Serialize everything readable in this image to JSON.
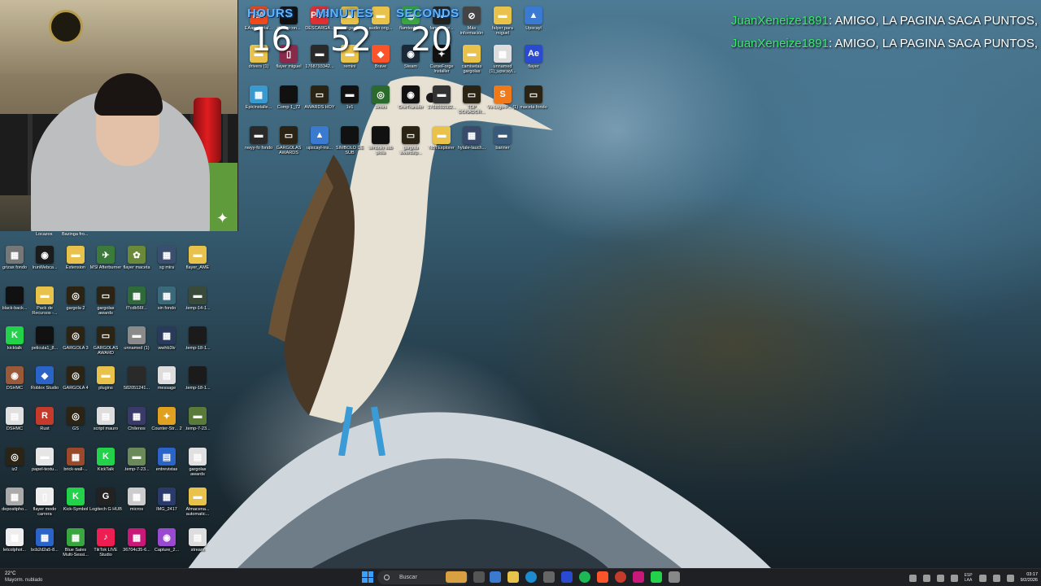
{
  "timer": {
    "hours_label": "HOURS",
    "minutes_label": "MINUTES",
    "seconds_label": "SECONDS",
    "hours": "16",
    "minutes": "52",
    "seconds": "20"
  },
  "chat": [
    {
      "user": "JuanXeneize1891",
      "message": ": AMIGO, LA PAGINA SACA PUNTOS,"
    },
    {
      "user": "JuanXeneize1891",
      "message": ": AMIGO, LA PAGINA SACA PUNTOS,"
    }
  ],
  "webcam": {
    "caption_left": "Locazos",
    "caption_right": "Bazinga fro..."
  },
  "desktop_icons": [
    {
      "label": "grizas fondo",
      "color": "#777777",
      "glyph": "▦"
    },
    {
      "label": "IrunWebca...",
      "color": "#1b1b1b",
      "glyph": "◉"
    },
    {
      "label": "Extension",
      "color": "#e8c24a",
      "glyph": "▬"
    },
    {
      "label": "MSI Afterburner",
      "color": "#3c7a3c",
      "glyph": "✈"
    },
    {
      "label": "flayer maceta",
      "color": "#6a8a3a",
      "glyph": "✿"
    },
    {
      "label": "sg mira",
      "color": "#3a4f6f",
      "glyph": "▦"
    },
    {
      "label": "flayer_AME",
      "color": "#e8c24a",
      "glyph": "▬"
    },
    {
      "label": "black-back...",
      "color": "#111111",
      "glyph": ""
    },
    {
      "label": "Pack de Recursos -...",
      "color": "#e8c24a",
      "glyph": "▬"
    },
    {
      "label": "gargola 2",
      "color": "#2b2313",
      "glyph": "◎"
    },
    {
      "label": "gargolas awards",
      "color": "#2b2313",
      "glyph": "▭"
    },
    {
      "label": "f7cdb56f...",
      "color": "#2f6b3a",
      "glyph": "▦"
    },
    {
      "label": "sin fondo",
      "color": "#3a6a7a",
      "glyph": "▦"
    },
    {
      "label": ".temp-14-1...",
      "color": "#3a4a3a",
      "glyph": "▬"
    },
    {
      "label": "kicktalk",
      "color": "#23d14a",
      "glyph": "K"
    },
    {
      "label": "pelicula1_8...",
      "color": "#111111",
      "glyph": ""
    },
    {
      "label": "GARGOLA 3",
      "color": "#2b2313",
      "glyph": "◎"
    },
    {
      "label": "GARGOLAS AWARD",
      "color": "#2b2313",
      "glyph": "▭"
    },
    {
      "label": "unnamed (1)",
      "color": "#8a8a8a",
      "glyph": "▬"
    },
    {
      "label": "wwhb3lv",
      "color": "#2a3a5a",
      "glyph": "▦"
    },
    {
      "label": ".temp-18-1...",
      "color": "#1b1b1b",
      "glyph": ""
    },
    {
      "label": "DSHMC",
      "color": "#9a5a3a",
      "glyph": "◉"
    },
    {
      "label": "Roblox Studio",
      "color": "#2a64c8",
      "glyph": "◆"
    },
    {
      "label": "GARGOLA 4",
      "color": "#2b2313",
      "glyph": "◎"
    },
    {
      "label": "plugins",
      "color": "#e8c24a",
      "glyph": "▬"
    },
    {
      "label": "582051241...",
      "color": "#2a2a2a",
      "glyph": ""
    },
    {
      "label": "message",
      "color": "#dddddd",
      "glyph": "▤"
    },
    {
      "label": ".temp-18-1...",
      "color": "#1b1b1b",
      "glyph": ""
    },
    {
      "label": "DSHMC",
      "color": "#e0e0e0",
      "glyph": "▤"
    },
    {
      "label": "Rust",
      "color": "#c43b2b",
      "glyph": "R"
    },
    {
      "label": "GS",
      "color": "#2b2313",
      "glyph": "◎"
    },
    {
      "label": "script mauro",
      "color": "#dddddd",
      "glyph": "▤"
    },
    {
      "label": "Chilenos",
      "color": "#3a3a6a",
      "glyph": "▦"
    },
    {
      "label": "Counter-Str... 2",
      "color": "#e0a020",
      "glyph": "✦"
    },
    {
      "label": ".temp-7-23...",
      "color": "#5a7a3a",
      "glyph": "▬"
    },
    {
      "label": "iz2",
      "color": "#2b2313",
      "glyph": "◎"
    },
    {
      "label": "papel-textu...",
      "color": "#e6e6e6",
      "glyph": "▬"
    },
    {
      "label": "brick-wall-...",
      "color": "#9a4a2a",
      "glyph": "▦"
    },
    {
      "label": "KickTalk",
      "color": "#23d14a",
      "glyph": "K"
    },
    {
      "label": ".temp-7-23...",
      "color": "#6a8a5a",
      "glyph": "▬"
    },
    {
      "label": "entrevistas",
      "color": "#2a64c8",
      "glyph": "▤"
    },
    {
      "label": "gargolas awards",
      "color": "#e0e0e0",
      "glyph": "▤"
    },
    {
      "label": "depositpho...",
      "color": "#aaaaaa",
      "glyph": "▦"
    },
    {
      "label": "flayer modo carrera",
      "color": "#eeeeee",
      "glyph": "▯"
    },
    {
      "label": "Kick-Symbol",
      "color": "#23d14a",
      "glyph": "K"
    },
    {
      "label": "Logitech G HUB",
      "color": "#222222",
      "glyph": "G"
    },
    {
      "label": "micros",
      "color": "#cccccc",
      "glyph": "▦"
    },
    {
      "label": "IMG_2417",
      "color": "#2a3a6a",
      "glyph": "▦"
    },
    {
      "label": "Almacena... automatic...",
      "color": "#e8c24a",
      "glyph": "▬"
    },
    {
      "label": "letcolphot...",
      "color": "#eeeeee",
      "glyph": "▦"
    },
    {
      "label": "bcb2d2a5-8...",
      "color": "#2a64c8",
      "glyph": "▦"
    },
    {
      "label": "Blue Sales Multi-Sessi...",
      "color": "#3aa640",
      "glyph": "▦"
    },
    {
      "label": "TikTok LIVE Studio",
      "color": "#ee1d52",
      "glyph": "♪"
    },
    {
      "label": "36704c35-6...",
      "color": "#c8197a",
      "glyph": "▦"
    },
    {
      "label": "Capture_2...",
      "color": "#9a4ad0",
      "glyph": "◉"
    },
    {
      "label": "stream",
      "color": "#dddddd",
      "glyph": "▤"
    },
    {
      "label": "EAappInstal...",
      "color": "#f04a1a",
      "glyph": "EA"
    },
    {
      "label": "tiktok-icon...",
      "color": "#111111",
      "glyph": "♪"
    },
    {
      "label": "DESCARGA...",
      "color": "#e03030",
      "glyph": "PDF"
    },
    {
      "label": "prestige_3...",
      "color": "#e8c24a",
      "glyph": "▬"
    },
    {
      "label": "audio orig...",
      "color": "#e8c24a",
      "glyph": "▬"
    },
    {
      "label": "flamtecks 3",
      "color": "#3aa640",
      "glyph": "◉"
    },
    {
      "label": "fam-textur...",
      "color": "#222222",
      "glyph": "▬"
    },
    {
      "label": "Más información",
      "color": "#444444",
      "glyph": "⊘"
    },
    {
      "label": "falyer para miguel",
      "color": "#e8c24a",
      "glyph": "▬"
    },
    {
      "label": "Upscayl",
      "color": "#3a7ad0",
      "glyph": "▲"
    },
    {
      "label": "drivers (1)",
      "color": "#e8c24a",
      "glyph": "▬"
    },
    {
      "label": "flayer miguel",
      "color": "#8a2a4a",
      "glyph": "▯"
    },
    {
      "label": "1768793342...",
      "color": "#2a2a2a",
      "glyph": "▬"
    },
    {
      "label": "remini",
      "color": "#e8c24a",
      "glyph": "▬"
    },
    {
      "label": "Brave",
      "color": "#fb542b",
      "glyph": "◆"
    },
    {
      "label": "Steam",
      "color": "#1b2838",
      "glyph": "◉"
    },
    {
      "label": "CurseForge Installer",
      "color": "#111111",
      "glyph": "✦"
    },
    {
      "label": "camisetas gargolas",
      "color": "#e8c24a",
      "glyph": "▬"
    },
    {
      "label": "unnamed (1)_upscayl...",
      "color": "#dddddd",
      "glyph": "▦"
    },
    {
      "label": "flayer",
      "color": "#2a4ad0",
      "glyph": "Ae"
    },
    {
      "label": "Epicinstalle...",
      "color": "#3a9ad0",
      "glyph": "▦"
    },
    {
      "label": "Comp 1_72",
      "color": "#111111",
      "glyph": ""
    },
    {
      "label": "AWARDS HOY",
      "color": "#2b2313",
      "glyph": "▭"
    },
    {
      "label": "1v1",
      "color": "#111111",
      "glyph": "▬"
    },
    {
      "label": "Jimini",
      "color": "#2a6a2a",
      "glyph": "◎"
    },
    {
      "label": "OneTransfer",
      "color": "#111111",
      "glyph": "◉"
    },
    {
      "label": "1768592082...",
      "color": "#333333",
      "glyph": "▬"
    },
    {
      "label": "TOP DONADOR...",
      "color": "#2b2313",
      "glyph": "▭"
    },
    {
      "label": "Vs-Logo-P... (1)",
      "color": "#f07a1a",
      "glyph": "S"
    },
    {
      "label": "maceta fondo",
      "color": "#2b2313",
      "glyph": "▭"
    },
    {
      "label": "nwyy-fo fondo",
      "color": "#2a2a2a",
      "glyph": "▬"
    },
    {
      "label": "GARGOLAS AWARDS",
      "color": "#2b2313",
      "glyph": "▭"
    },
    {
      "label": "upscayl-ins...",
      "color": "#3a7ad0",
      "glyph": "▲"
    },
    {
      "label": "SIMBOLO DE SUB",
      "color": "#111111",
      "glyph": ""
    },
    {
      "label": "simbolo sub piola",
      "color": "#111111",
      "glyph": ""
    },
    {
      "label": "gargola awardstp...",
      "color": "#2b2313",
      "glyph": "▭"
    },
    {
      "label": "NBTExplorer",
      "color": "#e8c24a",
      "glyph": "▬"
    },
    {
      "label": "hytale-lauch...",
      "color": "#3a4a6a",
      "glyph": "▦"
    },
    {
      "label": "banner",
      "color": "#3a5a7a",
      "glyph": "▬"
    }
  ],
  "taskbar": {
    "weather_temp": "22°C",
    "weather_desc": "Mayorm. nublado",
    "search_placeholder": "Buscar",
    "language_top": "ESP",
    "language_bottom": "LAA",
    "time": "03:17",
    "date": "9/2/2026"
  }
}
